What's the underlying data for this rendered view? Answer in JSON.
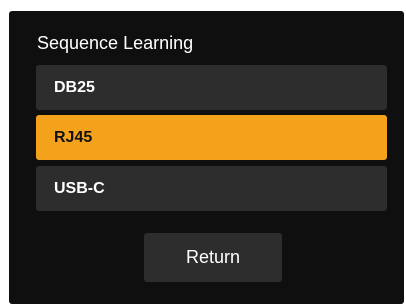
{
  "dialog": {
    "title": "Sequence Learning",
    "options": [
      {
        "label": "DB25",
        "selected": false
      },
      {
        "label": "RJ45",
        "selected": true
      },
      {
        "label": "USB-C",
        "selected": false
      }
    ],
    "return_label": "Return"
  },
  "colors": {
    "panel_bg": "#0f0f0f",
    "option_bg": "#2d2d2d",
    "selected_accent": "#f4a21c",
    "text": "#ffffff"
  }
}
